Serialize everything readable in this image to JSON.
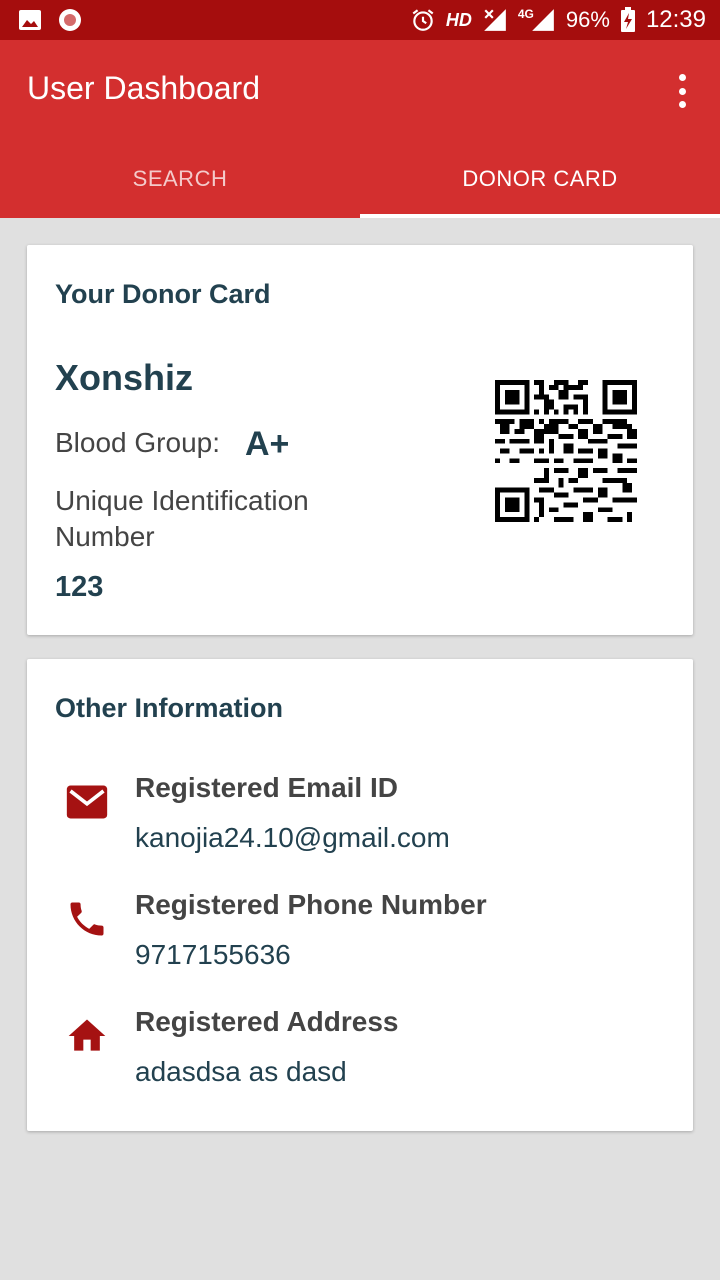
{
  "status_bar": {
    "network_label": "HD",
    "network_type": "4G",
    "battery": "96%",
    "time": "12:39"
  },
  "app_bar": {
    "title": "User Dashboard",
    "tabs": [
      {
        "label": "SEARCH",
        "active": false
      },
      {
        "label": "DONOR CARD",
        "active": true
      }
    ]
  },
  "donor_card": {
    "title": "Your Donor Card",
    "name": "Xonshiz",
    "blood_group_label": "Blood Group:",
    "blood_group": "A+",
    "uid_label": "Unique Identification Number",
    "uid": "123"
  },
  "other_info": {
    "title": "Other Information",
    "items": [
      {
        "icon": "email-icon",
        "label": "Registered Email ID",
        "value": "kanojia24.10@gmail.com"
      },
      {
        "icon": "phone-icon",
        "label": "Registered Phone Number",
        "value": "9717155636"
      },
      {
        "icon": "home-icon",
        "label": "Registered Address",
        "value": "adasdsa as dasd"
      }
    ]
  },
  "colors": {
    "status_bar": "#a50d0d",
    "primary": "#d32f2f",
    "icon_red": "#a51212",
    "heading_text": "#22414f"
  }
}
